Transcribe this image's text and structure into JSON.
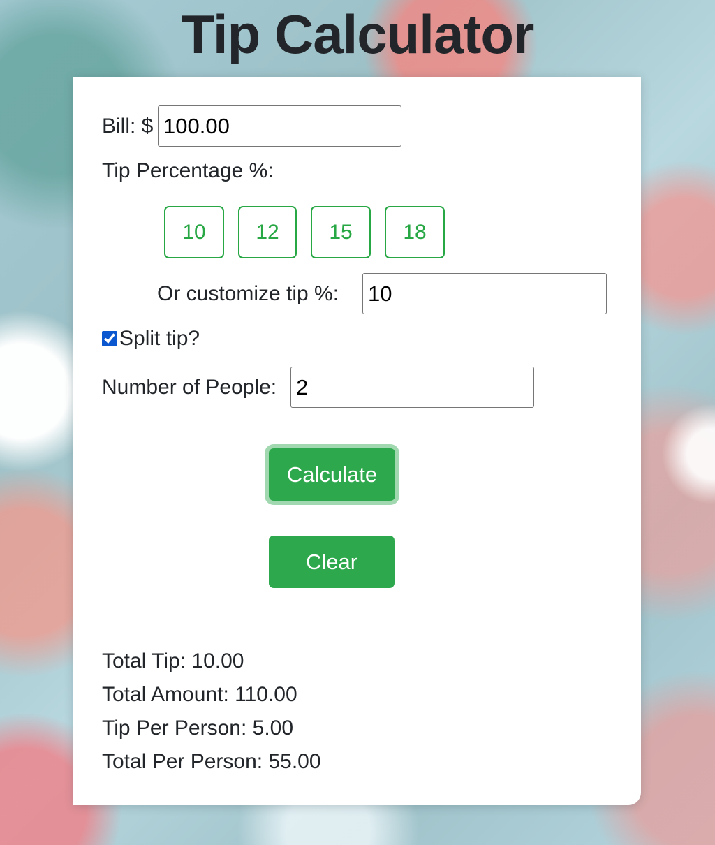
{
  "app": {
    "title": "Tip Calculator"
  },
  "form": {
    "bill_label": "Bill: $",
    "bill_value": "100.00",
    "tip_percentage_label": "Tip Percentage %:",
    "tip_options": [
      "10",
      "12",
      "15",
      "18"
    ],
    "custom_tip_label": "Or customize tip %:",
    "custom_tip_value": "10",
    "split_tip_label": "Split tip?",
    "split_tip_checked": true,
    "people_label": "Number of People:",
    "people_value": "2",
    "calculate_label": "Calculate",
    "clear_label": "Clear"
  },
  "results": {
    "total_tip": "Total Tip: 10.00",
    "total_amount": "Total Amount: 110.00",
    "tip_per_person": "Tip Per Person: 5.00",
    "total_per_person": "Total Per Person: 55.00"
  },
  "colors": {
    "accent": "#28a745",
    "text": "#212529",
    "card_background": "#ffffff",
    "checkbox": "#0b57d0"
  }
}
